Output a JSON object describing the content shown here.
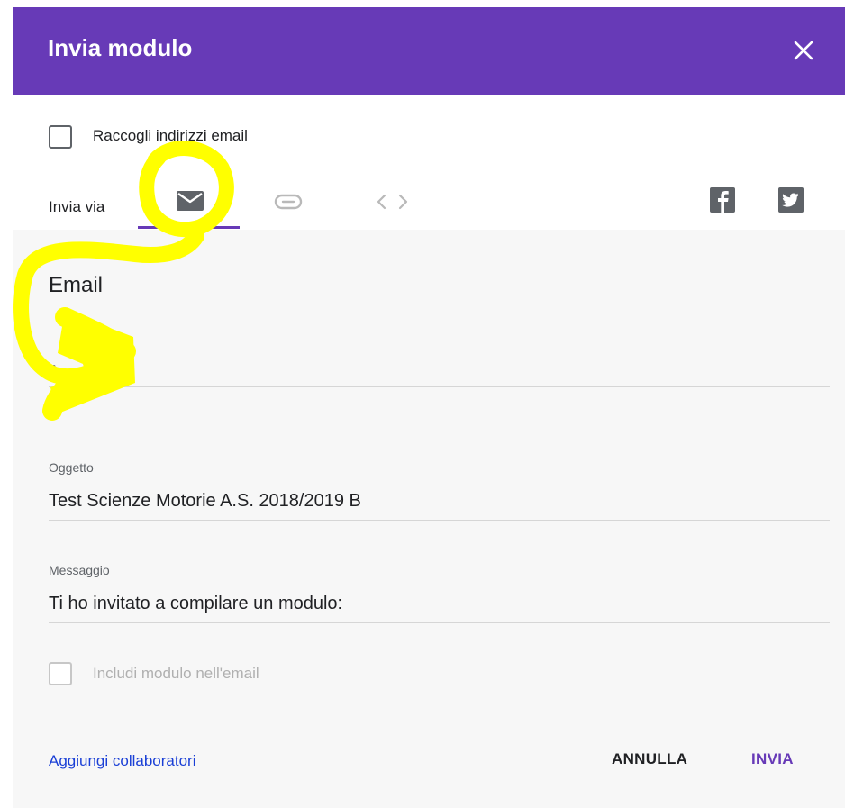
{
  "dialog": {
    "title": "Invia modulo",
    "close_icon": "close-icon",
    "header_color": "#673ab7"
  },
  "collect_emails": {
    "label": "Raccogli indirizzi email",
    "checked": false
  },
  "send_via": {
    "label": "Invia via",
    "tabs": [
      {
        "icon": "email-icon",
        "selected": true
      },
      {
        "icon": "link-icon",
        "selected": false
      },
      {
        "icon": "embed-code-icon",
        "selected": false
      }
    ],
    "social": [
      {
        "icon": "facebook-icon"
      },
      {
        "icon": "twitter-icon"
      }
    ]
  },
  "email": {
    "section_title": "Email",
    "to_placeholder": "A",
    "subject_label": "Oggetto",
    "subject_value": "Test Scienze Motorie A.S. 2018/2019 B",
    "message_label": "Messaggio",
    "message_value": "Ti ho invitato a compilare un modulo:",
    "include_form_label": "Includi modulo nell'email",
    "include_form_checked": false
  },
  "footer": {
    "add_collaborators_label": "Aggiungi collaboratori",
    "cancel_label": "ANNULLA",
    "send_label": "INVIA",
    "send_color": "#673ab7"
  },
  "annotation_color": "#ffff00"
}
